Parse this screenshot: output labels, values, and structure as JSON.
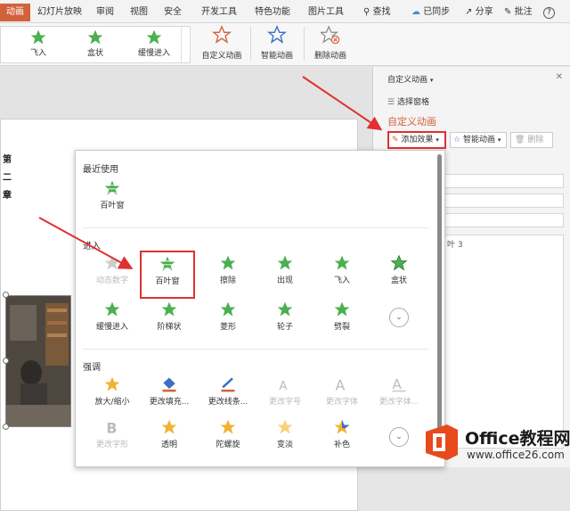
{
  "tabs": {
    "active": "动画",
    "slideshow": "幻灯片放映",
    "review": "审阅",
    "view": "视图",
    "security": "安全",
    "devtools": "开发工具",
    "features": "特色功能",
    "picture": "图片工具"
  },
  "toolbar_right": {
    "search": "查找",
    "synced": "已同步",
    "share": "分享",
    "comment": "批注",
    "help": "?"
  },
  "ribbon": {
    "gallery": [
      "飞入",
      "盒状",
      "缓慢进入"
    ],
    "custom_animation": "自定义动画",
    "smart_animation": "智能动画",
    "delete_animation": "删除动画"
  },
  "slide": {
    "text_lines": [
      "第",
      "二",
      "章"
    ]
  },
  "panel": {
    "title": "自定义动画",
    "select_pane": "选择窗格",
    "heading": "自定义动画",
    "add_effect": "添加效果",
    "smart_animation": "智能动画",
    "delete": "删除",
    "list_item": "叶 3"
  },
  "dropdown": {
    "recent_title": "最近使用",
    "recent_items": [
      "百叶窗"
    ],
    "enter_title": "进入",
    "enter_items": [
      "动态数字",
      "百叶窗",
      "擦除",
      "出现",
      "飞入",
      "盒状",
      "缓慢进入",
      "阶梯状",
      "菱形",
      "轮子",
      "劈裂"
    ],
    "emphasis_title": "强调",
    "emphasis_items": [
      "放大/缩小",
      "更改填充...",
      "更改线条...",
      "更改字号",
      "更改字体",
      "更改字体...",
      "更改字形",
      "透明",
      "陀螺旋",
      "变淡",
      "补色"
    ]
  },
  "watermark": {
    "brand": "Office教程网",
    "url": "www.office26.com"
  },
  "colors": {
    "accent": "#d2623a",
    "star_green": "#4caf50",
    "highlight": "#e03030",
    "arrow": "#e03030"
  }
}
